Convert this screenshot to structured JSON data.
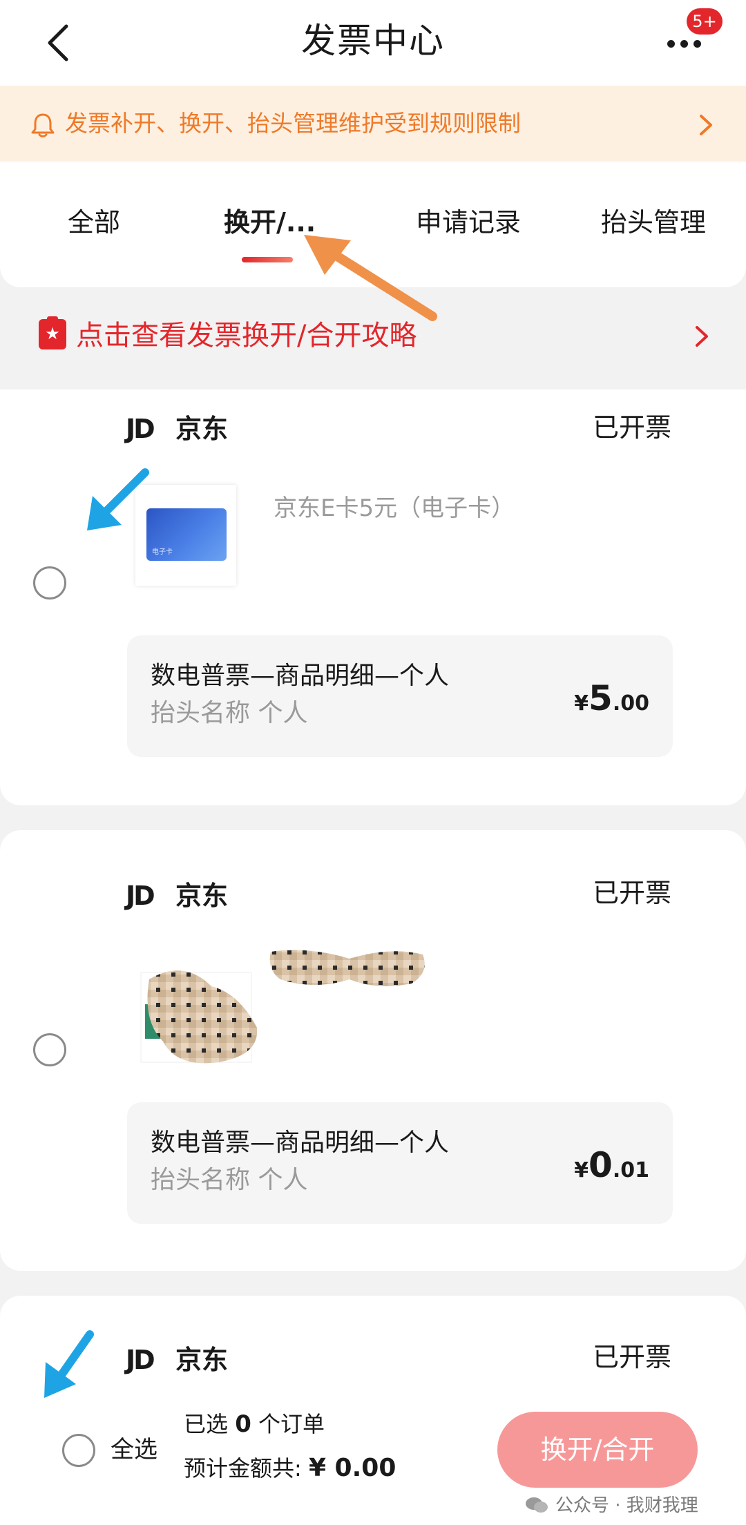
{
  "header": {
    "title": "发票中心",
    "badge": "5+"
  },
  "notice": {
    "text": "发票补开、换开、抬头管理维护受到规则限制"
  },
  "tabs": [
    {
      "label": "全部"
    },
    {
      "label": "换开/..."
    },
    {
      "label": "申请记录"
    },
    {
      "label": "抬头管理"
    }
  ],
  "guide": {
    "text": "点击查看发票换开/合开攻略"
  },
  "orders": [
    {
      "shop_logo": "JD",
      "shop_name": "京东",
      "status": "已开票",
      "product_title": "京东E卡5元（电子卡）",
      "thumb_label": "电子卡",
      "invoice_type": "数电普票—商品明细—个人",
      "invoice_header": "抬头名称 个人",
      "currency": "¥",
      "amount_int": "5",
      "amount_dec": ".00"
    },
    {
      "shop_logo": "JD",
      "shop_name": "京东",
      "status": "已开票",
      "product_title": "",
      "invoice_type": "数电普票—商品明细—个人",
      "invoice_header": "抬头名称 个人",
      "currency": "¥",
      "amount_int": "0",
      "amount_dec": ".01"
    },
    {
      "shop_logo": "JD",
      "shop_name": "京东",
      "status": "已开票"
    }
  ],
  "footer": {
    "select_all": "全选",
    "selected_prefix": "已选",
    "selected_count": "0",
    "selected_suffix": "个订单",
    "total_label": "预计金额共:",
    "total_value": "¥ 0.00",
    "action_button": "换开/合开"
  },
  "watermark": {
    "text": "公众号 · 我财我理"
  },
  "colors": {
    "accent_red": "#e3262b",
    "notice_orange": "#ee7a29",
    "notice_bg": "#fdf0e1",
    "button_pink": "#f79898",
    "annotation_orange": "#f0914a",
    "annotation_blue": "#1ea4e4"
  }
}
